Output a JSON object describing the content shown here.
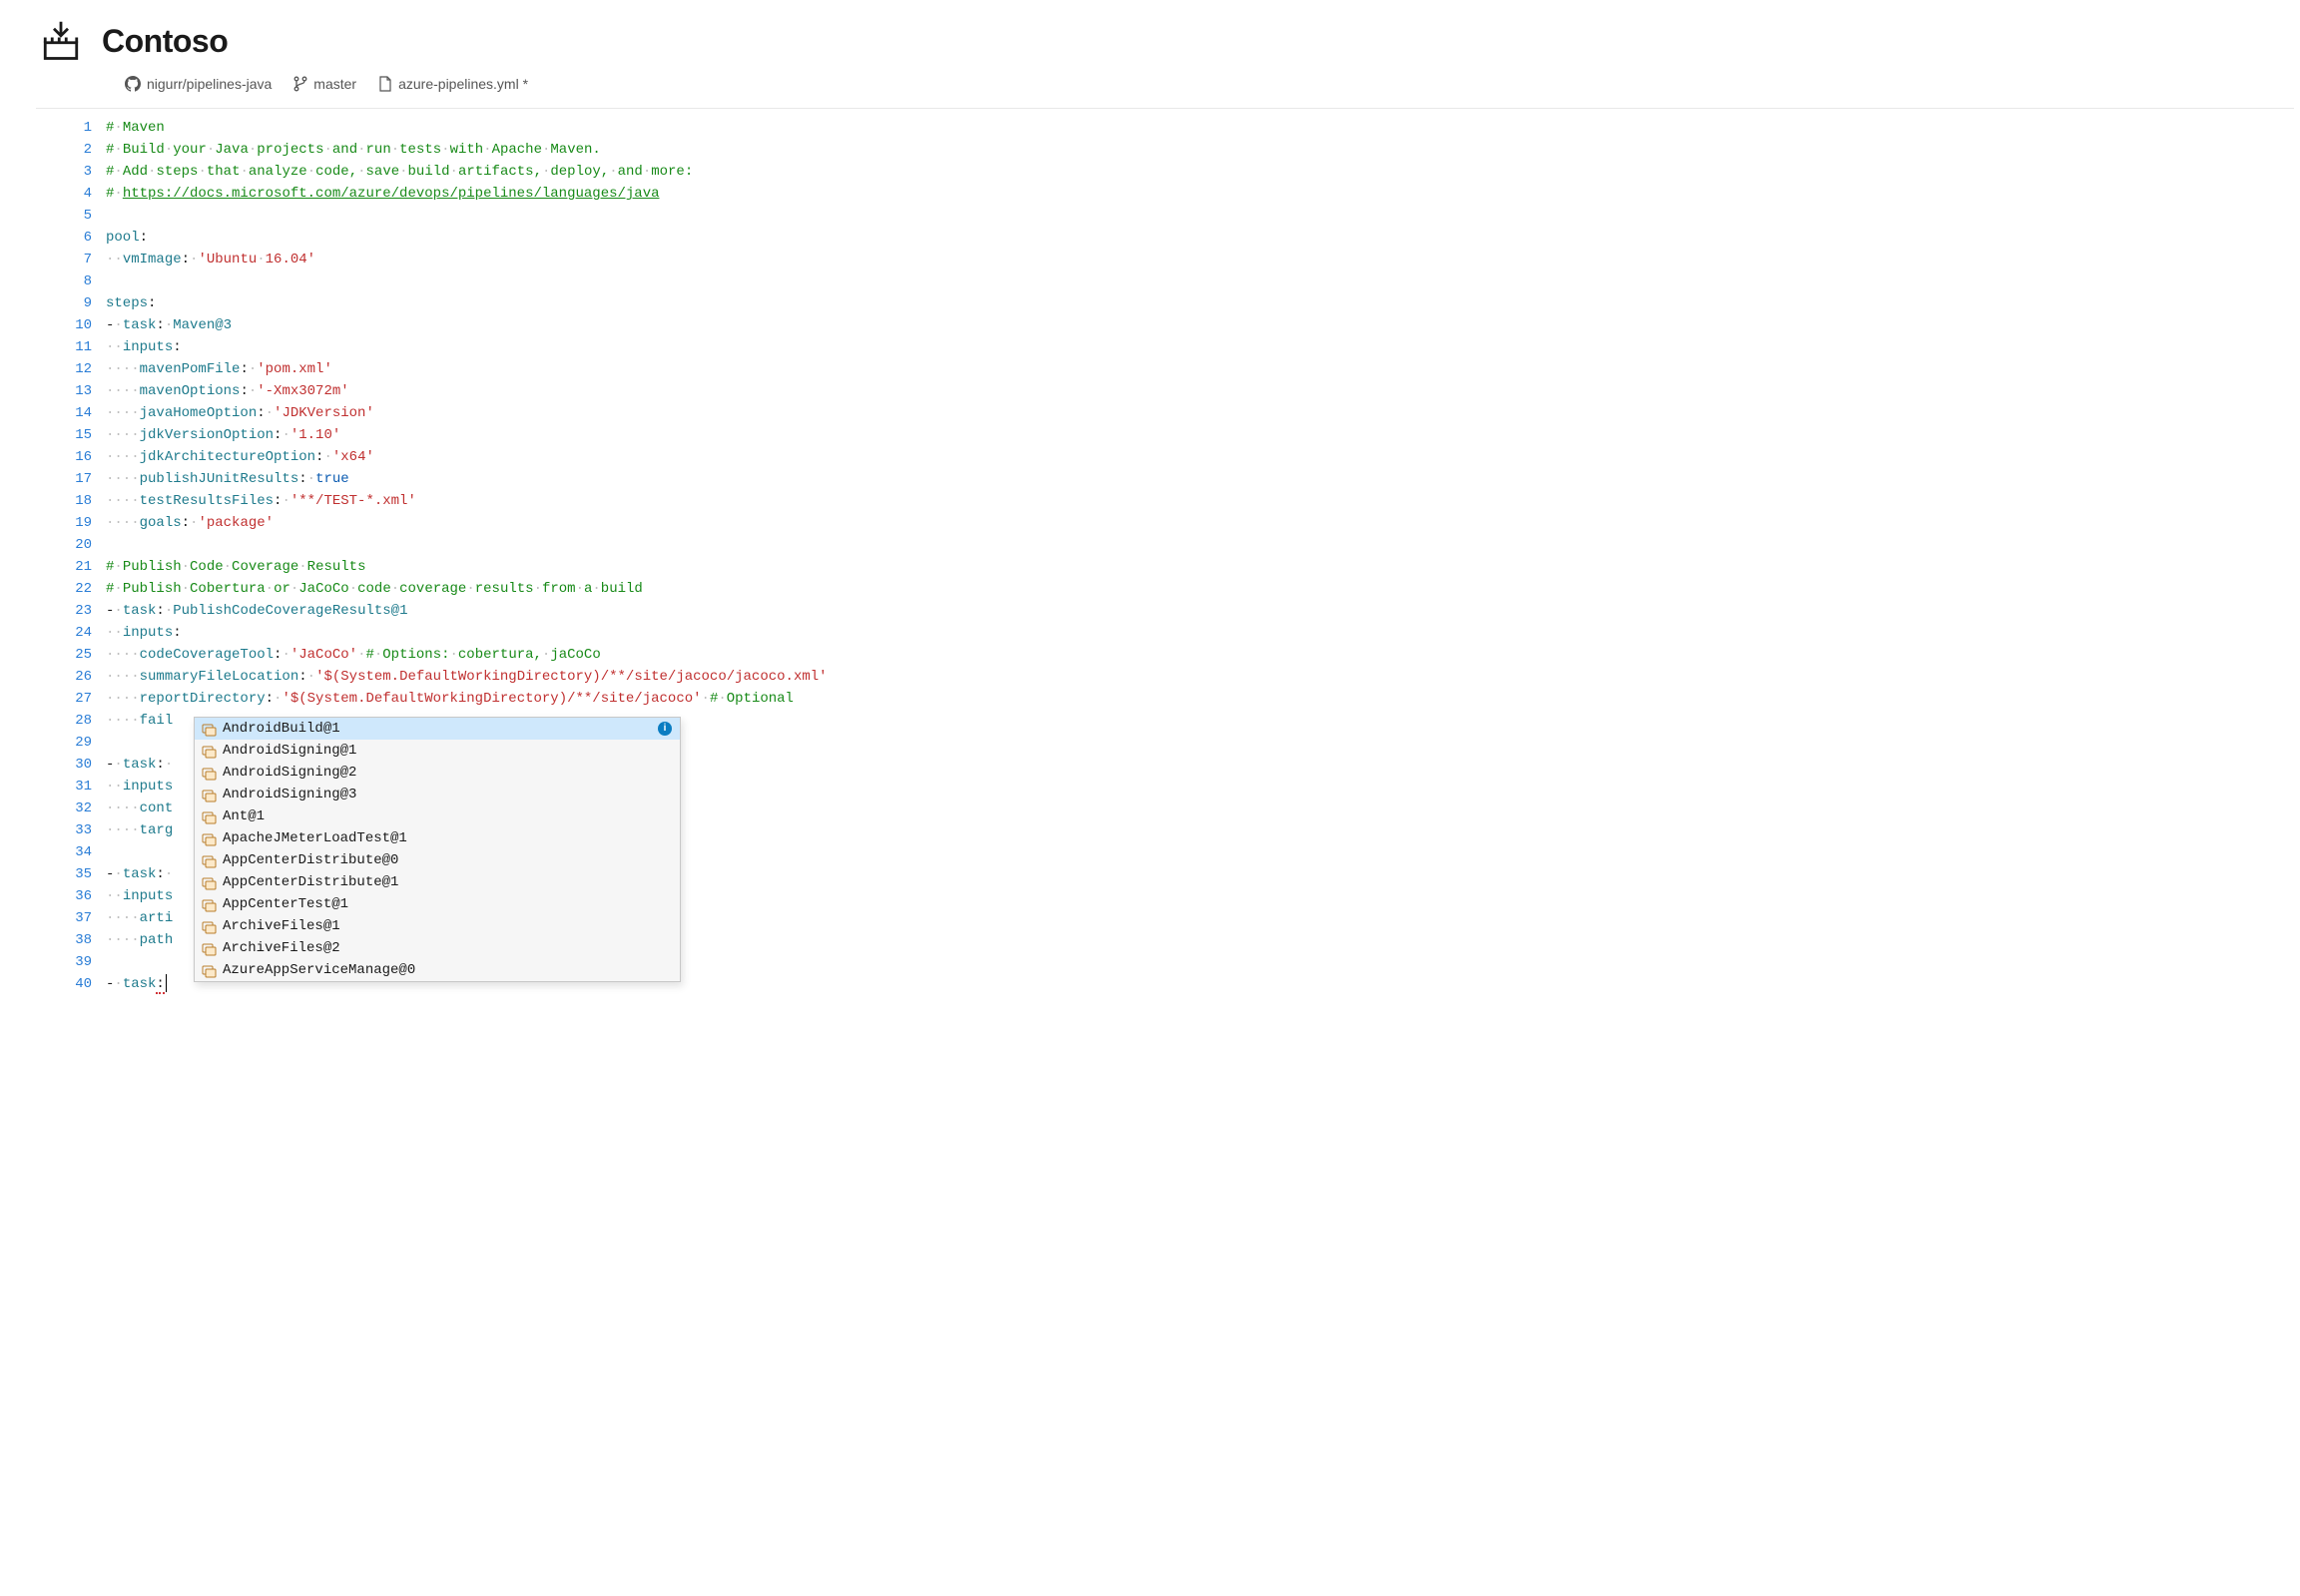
{
  "header": {
    "title": "Contoso"
  },
  "breadcrumbs": {
    "repo": "nigurr/pipelines-java",
    "branch": "master",
    "file": "azure-pipelines.yml *"
  },
  "code": {
    "lines": [
      {
        "t": "comment",
        "parts": [
          "#",
          " ",
          "Maven"
        ]
      },
      {
        "t": "comment",
        "parts": [
          "#",
          " ",
          "Build",
          " ",
          "your",
          " ",
          "Java",
          " ",
          "projects",
          " ",
          "and",
          " ",
          "run",
          " ",
          "tests",
          " ",
          "with",
          " ",
          "Apache",
          " ",
          "Maven."
        ]
      },
      {
        "t": "comment",
        "parts": [
          "#",
          " ",
          "Add",
          " ",
          "steps",
          " ",
          "that",
          " ",
          "analyze",
          " ",
          "code,",
          " ",
          "save",
          " ",
          "build",
          " ",
          "artifacts,",
          " ",
          "deploy,",
          " ",
          "and",
          " ",
          "more:"
        ]
      },
      {
        "t": "comment_url",
        "prefix": "# ",
        "url": "https://docs.microsoft.com/azure/devops/pipelines/languages/java"
      },
      {
        "t": "blank"
      },
      {
        "t": "kv",
        "indent": 0,
        "key": "pool",
        "val": null
      },
      {
        "t": "kv",
        "indent": 2,
        "key": "vmImage",
        "val": "'Ubuntu 16.04'",
        "vtype": "string"
      },
      {
        "t": "blank"
      },
      {
        "t": "kv",
        "indent": 0,
        "key": "steps",
        "val": null
      },
      {
        "t": "task",
        "indent": 0,
        "key": "task",
        "val": "Maven@3"
      },
      {
        "t": "kv",
        "indent": 2,
        "key": "inputs",
        "val": null
      },
      {
        "t": "kv",
        "indent": 4,
        "key": "mavenPomFile",
        "val": "'pom.xml'",
        "vtype": "string"
      },
      {
        "t": "kv",
        "indent": 4,
        "key": "mavenOptions",
        "val": "'-Xmx3072m'",
        "vtype": "string"
      },
      {
        "t": "kv",
        "indent": 4,
        "key": "javaHomeOption",
        "val": "'JDKVersion'",
        "vtype": "string"
      },
      {
        "t": "kv",
        "indent": 4,
        "key": "jdkVersionOption",
        "val": "'1.10'",
        "vtype": "string"
      },
      {
        "t": "kv",
        "indent": 4,
        "key": "jdkArchitectureOption",
        "val": "'x64'",
        "vtype": "string"
      },
      {
        "t": "kv",
        "indent": 4,
        "key": "publishJUnitResults",
        "val": "true",
        "vtype": "bool"
      },
      {
        "t": "kv",
        "indent": 4,
        "key": "testResultsFiles",
        "val": "'**/TEST-*.xml'",
        "vtype": "string"
      },
      {
        "t": "kv",
        "indent": 4,
        "key": "goals",
        "val": "'package'",
        "vtype": "string"
      },
      {
        "t": "blank"
      },
      {
        "t": "comment",
        "parts": [
          "#",
          " ",
          "Publish",
          " ",
          "Code",
          " ",
          "Coverage",
          " ",
          "Results"
        ]
      },
      {
        "t": "comment",
        "parts": [
          "#",
          " ",
          "Publish",
          " ",
          "Cobertura",
          " ",
          "or",
          " ",
          "JaCoCo",
          " ",
          "code",
          " ",
          "coverage",
          " ",
          "results",
          " ",
          "from",
          " ",
          "a",
          " ",
          "build"
        ]
      },
      {
        "t": "task",
        "indent": 0,
        "key": "task",
        "val": "PublishCodeCoverageResults@1"
      },
      {
        "t": "kv",
        "indent": 2,
        "key": "inputs",
        "val": null
      },
      {
        "t": "kv_trail",
        "indent": 4,
        "key": "codeCoverageTool",
        "val": "'JaCoCo'",
        "vtype": "string",
        "trail_parts": [
          "#",
          " ",
          "Options:",
          " ",
          "cobertura,",
          " ",
          "jaCoCo"
        ]
      },
      {
        "t": "kv",
        "indent": 4,
        "key": "summaryFileLocation",
        "val": "'$(System.DefaultWorkingDirectory)/**/site/jacoco/jacoco.xml'",
        "vtype": "string"
      },
      {
        "t": "kv_trail",
        "indent": 4,
        "key": "reportDirectory",
        "val": "'$(System.DefaultWorkingDirectory)/**/site/jacoco'",
        "vtype": "string",
        "trail_parts": [
          "#",
          " ",
          "Optional"
        ]
      },
      {
        "t": "frag",
        "indent": 4,
        "text": "fail"
      },
      {
        "t": "blank"
      },
      {
        "t": "task_open",
        "indent": 0,
        "key": "task",
        "after": " "
      },
      {
        "t": "frag",
        "indent": 2,
        "text": "inputs"
      },
      {
        "t": "frag",
        "indent": 4,
        "text": "cont"
      },
      {
        "t": "frag",
        "indent": 4,
        "text": "targ"
      },
      {
        "t": "blank"
      },
      {
        "t": "task_open",
        "indent": 0,
        "key": "task",
        "after": " "
      },
      {
        "t": "frag",
        "indent": 2,
        "text": "inputs"
      },
      {
        "t": "frag",
        "indent": 4,
        "text": "arti"
      },
      {
        "t": "frag",
        "indent": 4,
        "text": "path"
      },
      {
        "t": "blank"
      },
      {
        "t": "task_squiggle",
        "indent": 0,
        "key": "task",
        "caret": true
      }
    ]
  },
  "autocomplete": {
    "items": [
      {
        "label": "AndroidBuild@1",
        "selected": true
      },
      {
        "label": "AndroidSigning@1"
      },
      {
        "label": "AndroidSigning@2"
      },
      {
        "label": "AndroidSigning@3"
      },
      {
        "label": "Ant@1"
      },
      {
        "label": "ApacheJMeterLoadTest@1"
      },
      {
        "label": "AppCenterDistribute@0"
      },
      {
        "label": "AppCenterDistribute@1"
      },
      {
        "label": "AppCenterTest@1"
      },
      {
        "label": "ArchiveFiles@1"
      },
      {
        "label": "ArchiveFiles@2"
      },
      {
        "label": "AzureAppServiceManage@0"
      }
    ],
    "attach_line_index": 27
  }
}
